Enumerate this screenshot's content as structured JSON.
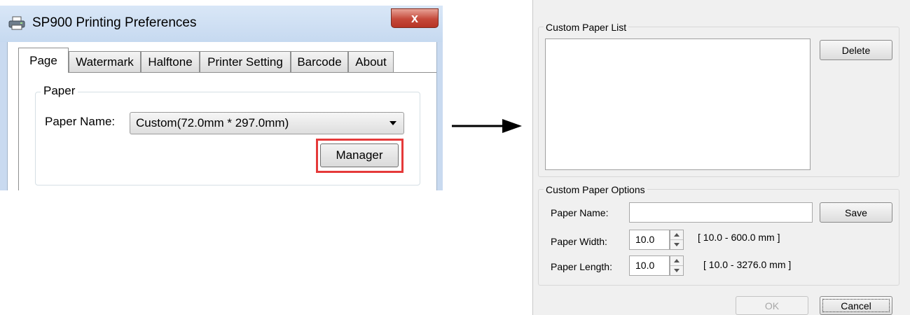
{
  "left_window": {
    "title": "SP900 Printing Preferences",
    "close_label": "x",
    "tabs": [
      {
        "label": "Page"
      },
      {
        "label": "Watermark"
      },
      {
        "label": "Halftone"
      },
      {
        "label": "Printer Setting"
      },
      {
        "label": "Barcode"
      },
      {
        "label": "About"
      }
    ],
    "active_tab": "Page",
    "paper_group": {
      "label": "Paper",
      "paper_name_label": "Paper Name:",
      "paper_name_value": "Custom(72.0mm * 297.0mm)",
      "manager_button": "Manager"
    }
  },
  "right_dialog": {
    "custom_paper_list_label": "Custom Paper List",
    "delete_button": "Delete",
    "options_label": "Custom Paper Options",
    "paper_name_label": "Paper Name:",
    "paper_name_value": "",
    "save_button": "Save",
    "paper_width_label": "Paper Width:",
    "paper_width_value": "10.0",
    "paper_width_range": "[ 10.0 - 600.0 mm ]",
    "paper_length_label": "Paper Length:",
    "paper_length_value": "10.0",
    "paper_length_range": "[ 10.0 - 3276.0 mm ]",
    "ok_button": "OK",
    "cancel_button": "Cancel"
  },
  "colors": {
    "highlight": "#e53a3a",
    "titlebar": "#c6d9f0",
    "close_button": "#c5493a",
    "dialog_bg": "#f0f0f0"
  },
  "icons": [
    "printer-icon",
    "close-icon",
    "chevron-down-icon",
    "arrow-right-icon",
    "spin-up-icon",
    "spin-down-icon"
  ]
}
